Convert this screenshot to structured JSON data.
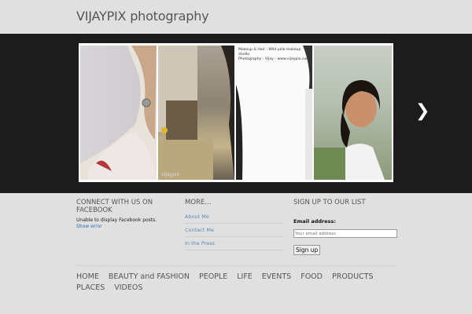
{
  "site": {
    "title": "VIJAYPIX photography"
  },
  "slider": {
    "caption_line1": "Makeup & Hair : Wild pink makeup studio",
    "caption_line2": "Photography : Vijay - www.vijaypix.com",
    "watermark": "vijaypix",
    "next_icon": "chevron-right-icon"
  },
  "facebook": {
    "title": "CONNECT WITH US ON FACEBOOK",
    "message": "Unable to display Facebook posts.",
    "error_link": "Show error"
  },
  "more": {
    "title": "MORE...",
    "links": [
      "About Me",
      "Contact Me",
      "In the Press"
    ]
  },
  "signup": {
    "title": "SIGN UP TO OUR LIST",
    "email_label": "Email address:",
    "email_placeholder": "Your email address",
    "button": "Sign up"
  },
  "nav": {
    "items": [
      "HOME",
      "BEAUTY and FASHION",
      "PEOPLE",
      "LIFE",
      "EVENTS",
      "FOOD",
      "PRODUCTS",
      "PLACES",
      "VIDEOS"
    ]
  }
}
